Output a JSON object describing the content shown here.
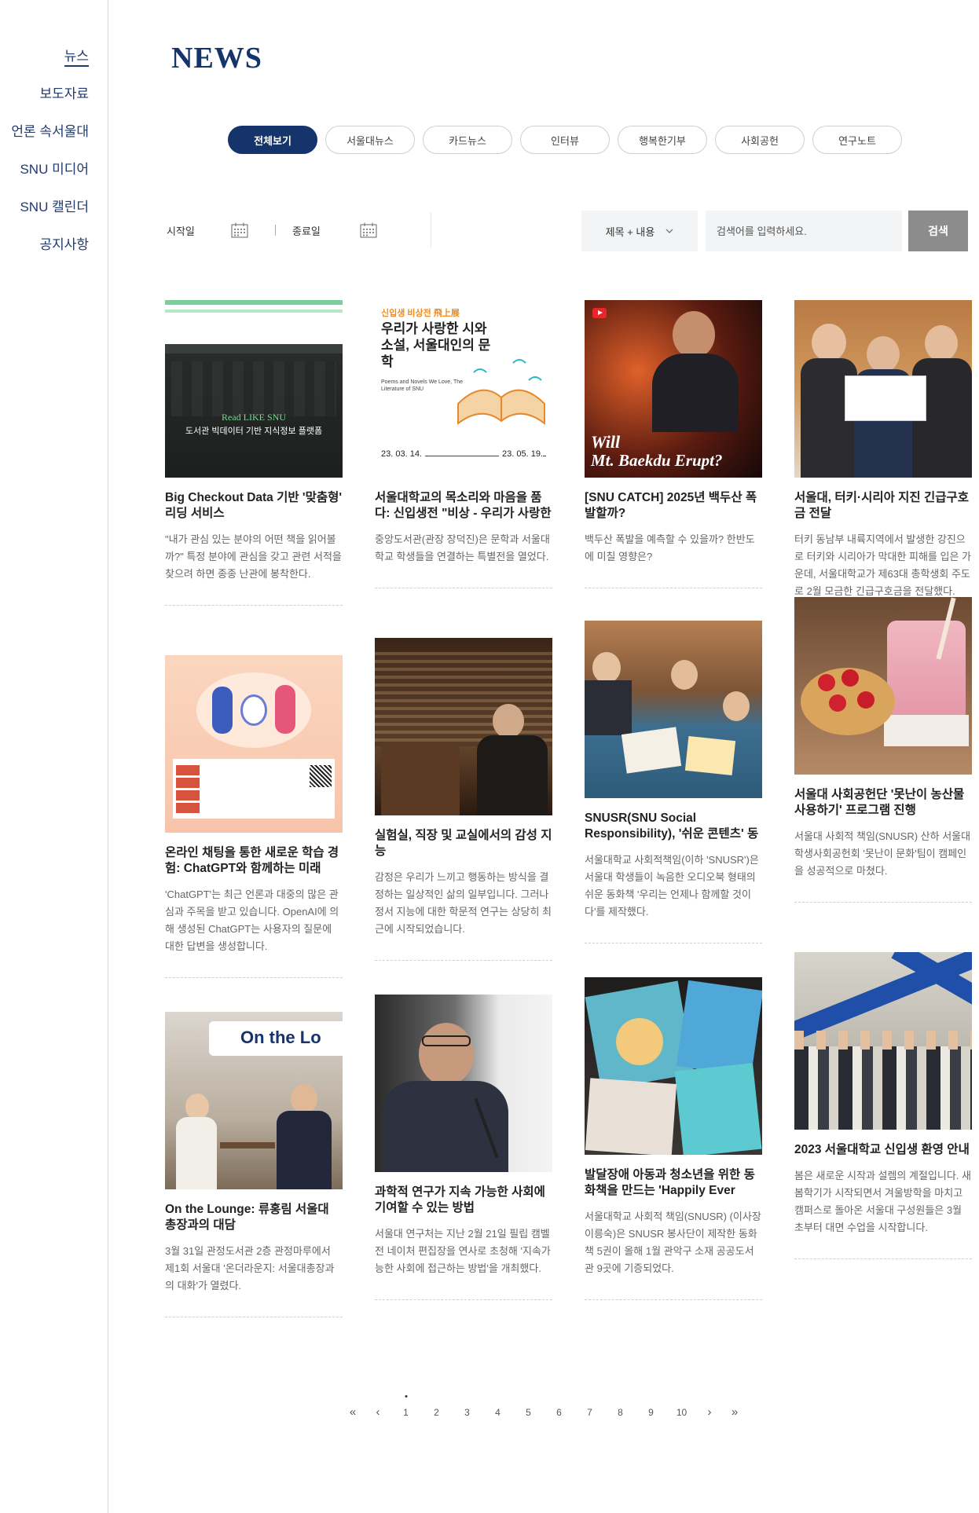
{
  "sidebar": {
    "items": [
      {
        "label": "뉴스"
      },
      {
        "label": "보도자료"
      },
      {
        "label": "언론 속서울대"
      },
      {
        "label": "SNU 미디어"
      },
      {
        "label": "SNU 캘린더"
      },
      {
        "label": "공지사항"
      }
    ]
  },
  "page_title": "NEWS",
  "tabs": [
    {
      "label": "전체보기"
    },
    {
      "label": "서울대뉴스"
    },
    {
      "label": "카드뉴스"
    },
    {
      "label": "인터뷰"
    },
    {
      "label": "행복한기부"
    },
    {
      "label": "사회공헌"
    },
    {
      "label": "연구노트"
    }
  ],
  "filter": {
    "start_label": "시작일",
    "end_label": "종료일",
    "select_value": "제목 + 내용",
    "search_placeholder": "검색어를 입력하세요.",
    "search_button": "검색"
  },
  "cards": [
    {
      "title": "Big Checkout Data 기반 '맞춤형' 리딩 서비스",
      "summary": "\"내가 관심 있는 분야의 어떤 책을 읽어볼까?\" 특정 분야에 관심을 갖고 관련 서적을 찾으려 하면 종종 난관에 봉착한다.",
      "thumb": {
        "read_like": "Read LIKE SNU",
        "caption": "도서관 빅데이터 기반 지식정보 플랫폼"
      }
    },
    {
      "title": "서울대학교의 목소리와 마음을 품다: 신입생전 \"비상 - 우리가 사랑한 시와 소설\"",
      "summary": "중앙도서관(관장 장덕진)은 문학과 서울대학교 학생들을 연결하는 특별전을 열었다.",
      "thumb": {
        "tag": "신입생 비상전 飛上展",
        "headline": "우리가 사랑한 시와 소설, 서울대인의 문학",
        "sub": "Poems and Novels We Love, The Literature of SNU",
        "date_from": "23. 03. 14.",
        "date_to": "23. 05. 19."
      }
    },
    {
      "title": "[SNU CATCH] 2025년 백두산 폭발할까?",
      "summary": "백두산 폭발을 예측할 수 있을까? 한반도에 미칠 영향은?",
      "thumb": {
        "line1": "Will",
        "line2": "Mt. Baekdu Erupt?"
      }
    },
    {
      "title": "서울대, 터키·시리아 지진 긴급구호금 전달",
      "summary": "터키 동남부 내륙지역에서 발생한 강진으로 터키와 시리아가 막대한 피해를 입은 가운데, 서울대학교가 제63대 총학생회 주도로 2월 모금한 긴급구호금을 전달했다."
    },
    {
      "title": "온라인 채팅을 통한 새로운 학습 경험: ChatGPT와 함께하는 미래",
      "summary": "'ChatGPT'는 최근 언론과 대중의 많은 관심과 주목을 받고 있습니다. OpenAI에 의해 생성된 ChatGPT는 사용자의 질문에 대한 답변을 생성합니다."
    },
    {
      "title": "실험실, 직장 및 교실에서의 감성 지능",
      "summary": "감정은 우리가 느끼고 행동하는 방식을 결정하는 일상적인 삶의 일부입니다. 그러나 정서 지능에 대한 학문적 연구는 상당히 최근에 시작되었습니다."
    },
    {
      "title": "SNUSR(SNU Social Responsibility), '쉬운 콘텐츠' 동화책 제작",
      "summary": "서울대학교 사회적책임(이하 'SNUSR')은 서울대 학생들이 녹음한 오디오북 형태의 쉬운 동화책 '우리는 언제나 함께할 것이다'를 제작했다."
    },
    {
      "title": "서울대 사회공헌단 '못난이 농산물 사용하기' 프로그램 진행",
      "summary": "서울대 사회적 책임(SNUSR) 산하 서울대 학생사회공헌회 '못난이 문화'팀이 캠페인을 성공적으로 마쳤다."
    },
    {
      "title": "On the Lounge: 류홍림 서울대 총장과의 대담",
      "summary": "3월 31일 관정도서관 2층 관정마루에서 제1회 서울대 '온더라운지: 서울대총장과의 대화'가 열렸다.",
      "thumb": {
        "banner": "On the Lo"
      }
    },
    {
      "title": "과학적 연구가 지속 가능한 사회에 기여할 수 있는 방법",
      "summary": "서울대 연구처는 지난 2월 21일 필립 캠벨 전 네이처 편집장을 연사로 초청해 '지속가능한 사회에 접근하는 방법'을 개최했다."
    },
    {
      "title": "발달장애 아동과 청소년을 위한 동화책을 만드는 'Happily Ever After'",
      "summary": "서울대학교 사회적 책임(SNUSR) (이사장 이릉숙)은 SNUSR 봉사단이 제작한 동화책 5권이 올해 1월 관악구 소재 공공도서관 9곳에 기증되었다."
    },
    {
      "title": "2023 서울대학교 신입생 환영 안내",
      "summary": "봄은 새로운 시작과 설렘의 계절입니다. 새 봄학기가 시작되면서 겨울방학을 마치고 캠퍼스로 돌아온 서울대 구성원들은 3월 초부터 대면 수업을 시작합니다."
    }
  ],
  "pagination": {
    "first": "«",
    "prev": "‹",
    "pages": [
      "1",
      "2",
      "3",
      "4",
      "5",
      "6",
      "7",
      "8",
      "9",
      "10"
    ],
    "next": "›",
    "last": "»",
    "current": "1"
  },
  "colors": {
    "brand": "#15346b",
    "search_button": "#8c8c8c",
    "filter_bg": "#f3f4f6"
  }
}
